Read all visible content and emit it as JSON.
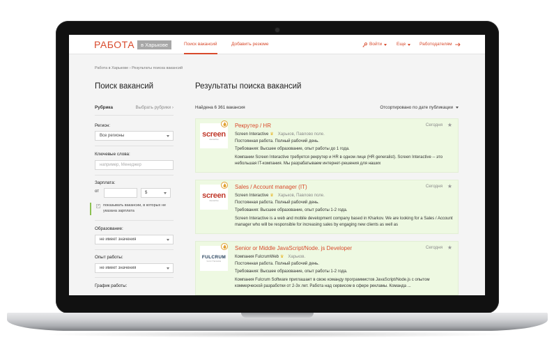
{
  "header": {
    "logo_main": "РАБОТА",
    "logo_city": "в Харькове",
    "tabs": [
      {
        "label": "Поиск вакансий"
      },
      {
        "label": "Добавить резюме"
      }
    ],
    "right": {
      "login": "Войти",
      "more": "Еще",
      "employers": "Работодателям"
    }
  },
  "breadcrumb": "Работа в Харькове › Результаты поиска вакансий",
  "sidebar": {
    "title": "Поиск вакансий",
    "rubric_label": "Рубрика",
    "rubric_link": "Выбрать рубрики ›",
    "region_label": "Регион:",
    "region_value": "Все регионы",
    "keywords_label": "Ключевые слова:",
    "keywords_placeholder": "например, Менеджер",
    "salary_label": "Зарплата:",
    "salary_from": "от",
    "currency": "$",
    "show_no_salary": "показывать вакансии, в которых не указана зарплата",
    "education_label": "Образование:",
    "education_value": "не имеет значения",
    "experience_label": "Опыт работы:",
    "experience_value": "не имеет значения",
    "schedule_label": "График работы:"
  },
  "results": {
    "title": "Результаты поиска вакансий",
    "count": "Найдена 6 361 вакансия",
    "sort": "Отсортировано по дате публикации",
    "jobs": [
      {
        "title": "Рекрутер / HR",
        "date": "Сегодня",
        "company": "Screen Interactive",
        "location": "Харьков, Павлово поле.",
        "employment": "Постоянная работа. Полный рабочий день.",
        "requirements": "Требования: Высшее образование, опыт работы до 1 года.",
        "description": "Компании Screen Interactive требуется рекрутер и HR в одном лице (HR generalist). Screen Interactive -- это небольшая IT-компания. Мы разрабатываем интернет-решения для наших",
        "logo_text": "screen",
        "logo_sub": "interactive"
      },
      {
        "title": "Sales / Account manager (IT)",
        "date": "Сегодня",
        "company": "Screen Interactive",
        "location": "Харьков, Павлово поле.",
        "employment": "Постоянная работа. Полный рабочий день.",
        "requirements": "Требования: Высшее образование, опыт работы 1-2 года.",
        "description": "Screen Interactive is a web and mobile development company based in Kharkov. We are looking for a Sales / Account manager who will be responsible for increasing sales by engaging new clients as well as",
        "logo_text": "screen",
        "logo_sub": "interactive"
      },
      {
        "title": "Senior or Middle JavaScript/Node. js Developer",
        "date": "Сегодня",
        "company": "Компания FulcrumWeb",
        "location": "Харьков.",
        "employment": "Постоянная работа. Полный рабочий день.",
        "requirements": "Требования: Высшее образование, опыт работы 1-2 года.",
        "description": "Компания Fulcrum Software приглашает в свою команду программистов JavaScript/Node.js с опытом коммерческой разработки от 2-3х лет. Работа над сервисом в сфере рекламы. Команда ...",
        "logo_text": "FULCRUM",
        "logo_sub": "SOFTWARE"
      }
    ]
  },
  "colors": {
    "accent": "#d84a2c",
    "card_bg": "#eef9e2",
    "check_bar": "#8cc152"
  }
}
